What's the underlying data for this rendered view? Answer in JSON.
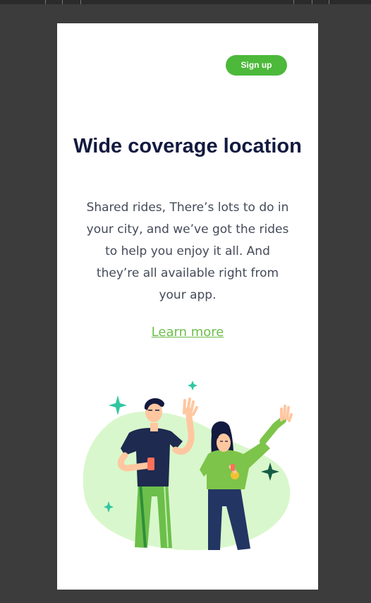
{
  "header": {
    "signup_label": "Sign up"
  },
  "content": {
    "title": "Wide coverage location",
    "body": "Shared rides, There’s lots to do in your city, and we’ve got the rides to help you enjoy it all. And they’re all available right from your app.",
    "link_label": "Learn more"
  },
  "colors": {
    "accent": "#4cb93a",
    "title": "#131a3f",
    "body_text": "#444a59",
    "link": "#6cbf4b",
    "blob": "#d9f7cc",
    "sparkle_teal": "#2fc7a1",
    "sparkle_dark": "#155c45"
  },
  "illustration": {
    "name": "two-people-waving-illustration",
    "icons": [
      "sparkle-icon",
      "phone-icon",
      "medal-icon"
    ]
  }
}
